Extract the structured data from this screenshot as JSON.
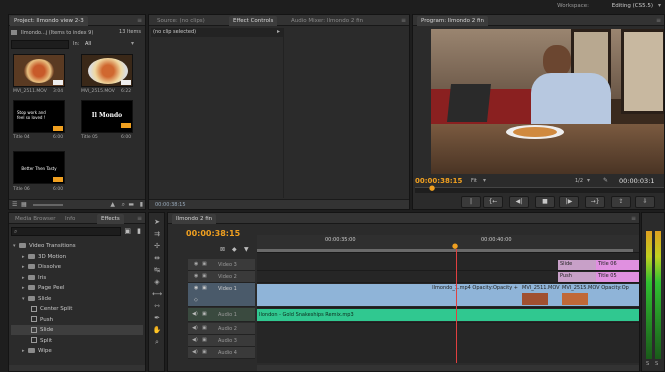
{
  "workspace": {
    "label": "Workspace:",
    "value": "Editing (CS5.5)"
  },
  "project": {
    "tab_label": "Project: Ilmondo view 2-3",
    "subtitle": "Ilmondo...j (Items to index 9)",
    "items_count": "13 Items",
    "search_in_label": "In:",
    "search_in_value": "All",
    "thumbnails": [
      {
        "title": "",
        "name": "MVI_2511.MOV",
        "duration": "3:04"
      },
      {
        "title": "",
        "name": "MVI_2515.MOV",
        "duration": "6:22"
      },
      {
        "title": "Stop work and\nfeel so loved !",
        "name": "Title 04",
        "duration": "6:00"
      },
      {
        "title": "Il Mondo",
        "name": "Title 05",
        "duration": "6:00"
      },
      {
        "title": "Better Then Tasty",
        "name": "Title 06",
        "duration": "6:00"
      }
    ]
  },
  "source": {
    "tabs": [
      "Source: (no clips)",
      "Effect Controls",
      "Audio Mixer: Ilmondo 2 fin"
    ],
    "no_clip": "(no clip selected)",
    "time": "00:00:38:15"
  },
  "program": {
    "tab_label": "Program: Ilmondo 2 fin",
    "timecode": "00:00:38:15",
    "fit": "Fit",
    "ratio": "1/2",
    "duration": "00:00:03:1"
  },
  "effects": {
    "tabs": [
      "Media Browser",
      "Info",
      "Effects",
      "Markers",
      "History"
    ],
    "tree": [
      {
        "label": "Video Transitions",
        "kind": "folder",
        "depth": 0,
        "open": true
      },
      {
        "label": "3D Motion",
        "kind": "folder",
        "depth": 1,
        "open": false
      },
      {
        "label": "Dissolve",
        "kind": "folder",
        "depth": 1,
        "open": false
      },
      {
        "label": "Iris",
        "kind": "folder",
        "depth": 1,
        "open": false
      },
      {
        "label": "Page Peel",
        "kind": "folder",
        "depth": 1,
        "open": false
      },
      {
        "label": "Slide",
        "kind": "folder",
        "depth": 1,
        "open": true
      },
      {
        "label": "Center Split",
        "kind": "preset",
        "depth": 2
      },
      {
        "label": "Push",
        "kind": "preset",
        "depth": 2
      },
      {
        "label": "Slide",
        "kind": "preset",
        "depth": 2
      },
      {
        "label": "Split",
        "kind": "preset",
        "depth": 2
      },
      {
        "label": "Wipe",
        "kind": "folder",
        "depth": 1,
        "open": false
      }
    ]
  },
  "timeline": {
    "tab_label": "Ilmondo 2 fin",
    "timecode": "00:00:38:15",
    "ruler": [
      "00:00:35:00",
      "00:00:40:00"
    ],
    "tracks": [
      {
        "name": "Video 3",
        "type": "video"
      },
      {
        "name": "Video 2",
        "type": "video"
      },
      {
        "name": "Video 1",
        "type": "video"
      },
      {
        "name": "Audio 1",
        "type": "audio"
      },
      {
        "name": "Audio 2",
        "type": "audio"
      },
      {
        "name": "Audio 3",
        "type": "audio"
      },
      {
        "name": "Audio 4",
        "type": "audio"
      }
    ],
    "clips": {
      "v3": [
        {
          "label": "Slide"
        },
        {
          "label": "Title 06"
        }
      ],
      "v2": [
        {
          "label": "Push"
        },
        {
          "label": "Title 05"
        }
      ],
      "v1": [
        {
          "label": "Ilmondo_1.mp4 Opacity:Opacity +"
        },
        {
          "label": "MVI_2511.MOV"
        },
        {
          "label": "MVI_2515.MOV Opacity:Op"
        }
      ],
      "a1": [
        {
          "label": "Ilondon - Gold Snakeships Remix.mp3"
        }
      ]
    }
  },
  "colors": {
    "accent": "#f0a020",
    "video_clip": "#8fb4d8",
    "audio_clip": "#30c890",
    "title_clip": "#d88ad8",
    "playhead": "#e04040"
  }
}
